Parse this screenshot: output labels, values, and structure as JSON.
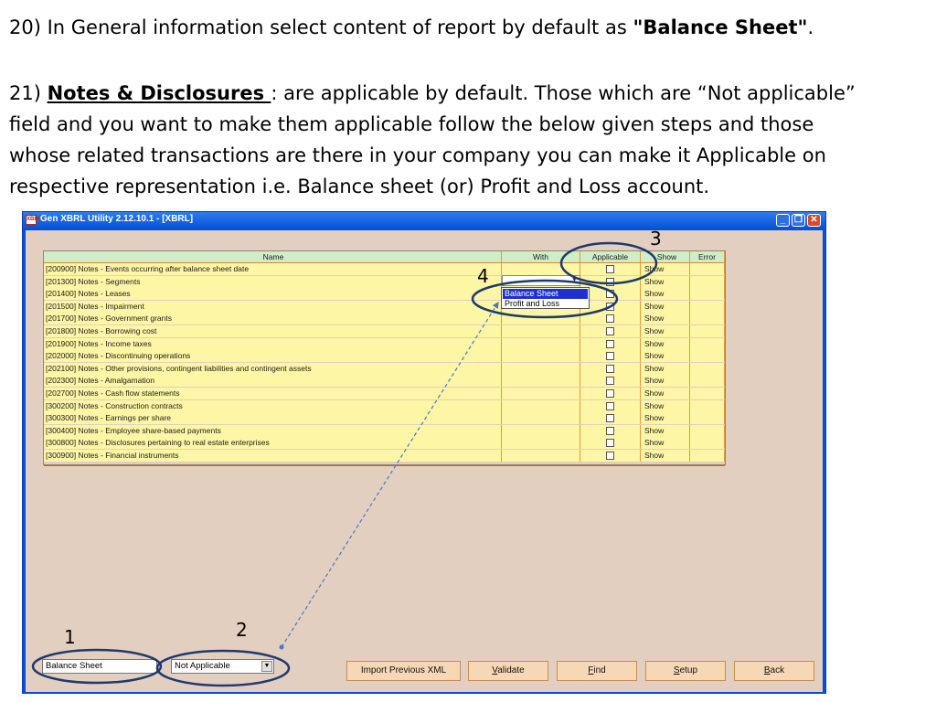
{
  "instructions": {
    "p20_prefix": "20)   In General information select content of report by default as ",
    "p20_bold": "\"Balance Sheet\"",
    "p20_suffix": ".",
    "p21_num": "21) ",
    "p21_heading": "Notes & Disclosures ",
    "p21_line1": ": are applicable by default. Those which are “Not applicable”",
    "p21_line2": "field and you want to make them applicable follow the below given steps and those",
    "p21_line3": "whose related transactions are there in your company you can make it Applicable on",
    "p21_line4": "respective representation i.e. Balance sheet (or) Profit and Loss account."
  },
  "window": {
    "title": "Gen XBRL Utility 2.12.10.1 - [XBRL]",
    "icon_text": "XBRL"
  },
  "grid": {
    "headers": {
      "name": "Name",
      "with": "With",
      "applicable": "Applicable",
      "show": "Show",
      "error": "Error"
    },
    "rows": [
      {
        "name": "[200900] Notes - Events occurring after balance sheet date",
        "show": "Show"
      },
      {
        "name": "[201300] Notes - Segments",
        "show": "Show"
      },
      {
        "name": "[201400] Notes - Leases",
        "show": "Show"
      },
      {
        "name": "[201500] Notes - Impairment",
        "show": "Show"
      },
      {
        "name": "[201700] Notes - Government grants",
        "show": "Show"
      },
      {
        "name": "[201800] Notes - Borrowing cost",
        "show": "Show"
      },
      {
        "name": "[201900] Notes - Income taxes",
        "show": "Show"
      },
      {
        "name": "[202000] Notes - Discontinuing operations",
        "show": "Show"
      },
      {
        "name": "[202100] Notes - Other provisions, contingent liabilities and contingent assets",
        "show": "Show"
      },
      {
        "name": "[202300] Notes - Amalgamation",
        "show": "Show"
      },
      {
        "name": "[202700] Notes - Cash flow statements",
        "show": "Show"
      },
      {
        "name": "[300200] Notes - Construction contracts",
        "show": "Show"
      },
      {
        "name": "[300300] Notes - Earnings per share",
        "show": "Show"
      },
      {
        "name": "[300400] Notes - Employee share-based payments",
        "show": "Show"
      },
      {
        "name": "[300800] Notes - Disclosures pertaining to real estate enterprises",
        "show": "Show"
      },
      {
        "name": "[300900] Notes - Financial instruments",
        "show": "Show"
      }
    ]
  },
  "with_dropdown": {
    "options": [
      "Balance Sheet",
      "Profit and Loss"
    ]
  },
  "footer": {
    "report_select": "Balance Sheet",
    "applicable_select": "Not Applicable",
    "import_btn": "Import Previous XML",
    "validate_key": "V",
    "validate_rest": "alidate",
    "find_key": "F",
    "find_rest": "ind",
    "setup_key": "S",
    "setup_rest": "etup",
    "back_key": "B",
    "back_rest": "ack"
  },
  "annotations": {
    "n1": "1",
    "n2": "2",
    "n3": "3",
    "n4": "4"
  },
  "colors": {
    "titlebar": "#0a52d8",
    "client_bg": "#e3cfc0",
    "grid_row": "#fdf6a4",
    "grid_header": "#cfeec4",
    "annotation": "#1f3a6e",
    "dropdown_selected": "#1e2fd4"
  }
}
